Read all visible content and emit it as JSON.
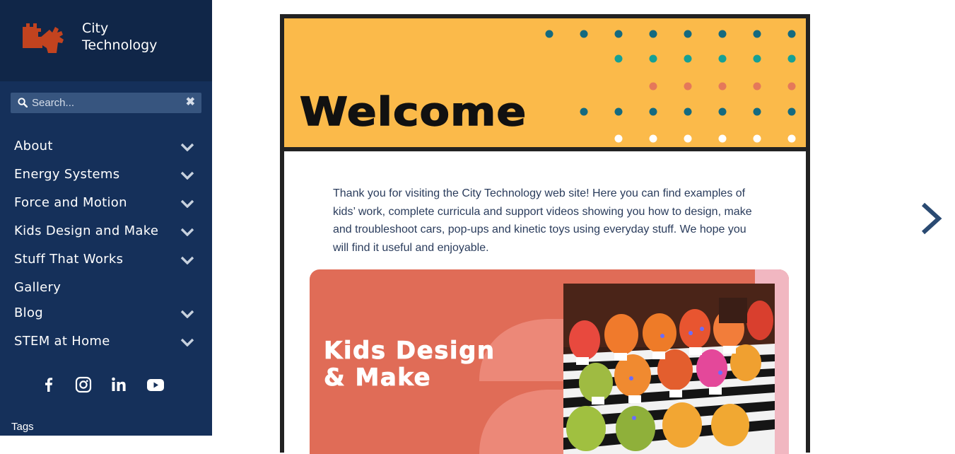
{
  "brand": {
    "line1": "City",
    "line2": "Technology"
  },
  "search": {
    "placeholder": "Search...",
    "clear": "✖"
  },
  "nav": [
    {
      "label": "About",
      "expandable": true
    },
    {
      "label": "Energy Systems",
      "expandable": true
    },
    {
      "label": "Force and Motion",
      "expandable": true
    },
    {
      "label": "Kids Design and Make",
      "expandable": true
    },
    {
      "label": "Stuff That Works",
      "expandable": true
    },
    {
      "label": "Gallery",
      "expandable": false
    },
    {
      "label": "Blog",
      "expandable": true
    },
    {
      "label": "STEM at Home",
      "expandable": true
    }
  ],
  "social": [
    "facebook-icon",
    "instagram-icon",
    "linkedin-icon",
    "youtube-icon"
  ],
  "sidebar_footer": {
    "tags_label": "Tags"
  },
  "banner": {
    "title": "Welcome"
  },
  "intro": "Thank you for visiting the City Technology web site! Here you can find examples of kids’ work, complete curricula and support videos showing you how to design, make and troubleshoot cars, pop-ups and kinetic toys using everyday stuff. We hope you will find it useful and enjoyable.",
  "feature": {
    "title_line1": "Kids Design",
    "title_line2": "& Make"
  },
  "colors": {
    "sidebar": "#15305a",
    "brand_bg": "#102648",
    "banner": "#fbba4a",
    "dot_navy": "#146a80",
    "dot_teal": "#16a095",
    "dot_coral": "#e5785a",
    "feature": "#e06c57",
    "feature_accent": "#f1b7c1",
    "arrow": "#2a4a72"
  }
}
